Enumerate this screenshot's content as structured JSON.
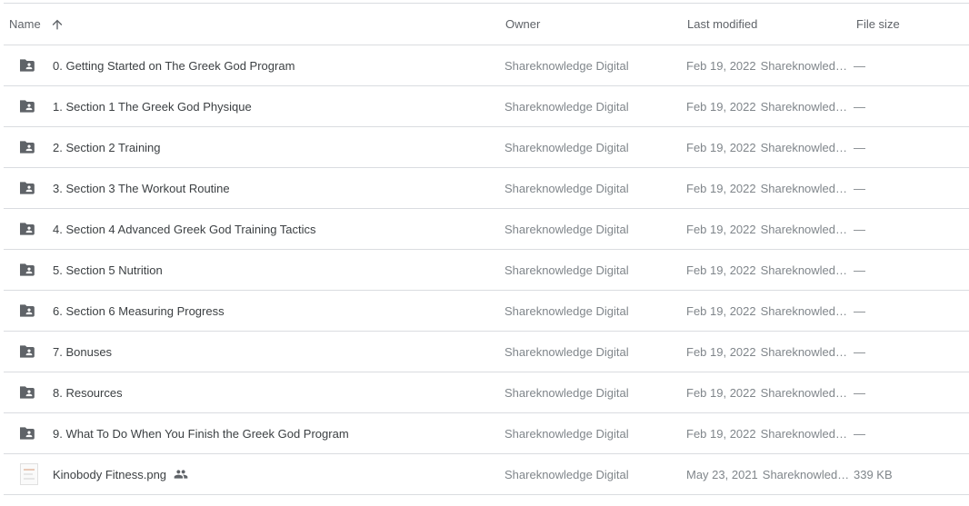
{
  "header": {
    "name": "Name",
    "owner": "Owner",
    "last_modified": "Last modified",
    "file_size": "File size",
    "sort_icon": "arrow-up-icon"
  },
  "rows": [
    {
      "name": "0. Getting Started on The Greek God Program",
      "type": "shared-folder",
      "owner": "Shareknowledge Digital",
      "date": "Feb 19, 2022",
      "modified_by": "Shareknowledge …",
      "size": "—"
    },
    {
      "name": "1. Section 1 The Greek God Physique",
      "type": "shared-folder",
      "owner": "Shareknowledge Digital",
      "date": "Feb 19, 2022",
      "modified_by": "Shareknowledge …",
      "size": "—"
    },
    {
      "name": "2. Section 2 Training",
      "type": "shared-folder",
      "owner": "Shareknowledge Digital",
      "date": "Feb 19, 2022",
      "modified_by": "Shareknowledge …",
      "size": "—"
    },
    {
      "name": "3. Section 3 The Workout Routine",
      "type": "shared-folder",
      "owner": "Shareknowledge Digital",
      "date": "Feb 19, 2022",
      "modified_by": "Shareknowledge …",
      "size": "—"
    },
    {
      "name": "4. Section 4 Advanced Greek God Training Tactics",
      "type": "shared-folder",
      "owner": "Shareknowledge Digital",
      "date": "Feb 19, 2022",
      "modified_by": "Shareknowledge …",
      "size": "—"
    },
    {
      "name": "5. Section 5 Nutrition",
      "type": "shared-folder",
      "owner": "Shareknowledge Digital",
      "date": "Feb 19, 2022",
      "modified_by": "Shareknowledge …",
      "size": "—"
    },
    {
      "name": "6. Section 6 Measuring Progress",
      "type": "shared-folder",
      "owner": "Shareknowledge Digital",
      "date": "Feb 19, 2022",
      "modified_by": "Shareknowledge …",
      "size": "—"
    },
    {
      "name": "7. Bonuses",
      "type": "shared-folder",
      "owner": "Shareknowledge Digital",
      "date": "Feb 19, 2022",
      "modified_by": "Shareknowledge …",
      "size": "—"
    },
    {
      "name": "8. Resources",
      "type": "shared-folder",
      "owner": "Shareknowledge Digital",
      "date": "Feb 19, 2022",
      "modified_by": "Shareknowledge …",
      "size": "—"
    },
    {
      "name": "9. What To Do When You Finish the Greek God Program",
      "type": "shared-folder",
      "owner": "Shareknowledge Digital",
      "date": "Feb 19, 2022",
      "modified_by": "Shareknowledge …",
      "size": "—"
    },
    {
      "name": "Kinobody Fitness.png",
      "type": "image-file",
      "shared": true,
      "owner": "Shareknowledge Digital",
      "date": "May 23, 2021",
      "modified_by": "Shareknowledge…",
      "size": "339 KB"
    }
  ],
  "colors": {
    "folder_icon": "#5f6368",
    "divider": "#dadce0",
    "secondary_text": "#80868b"
  }
}
